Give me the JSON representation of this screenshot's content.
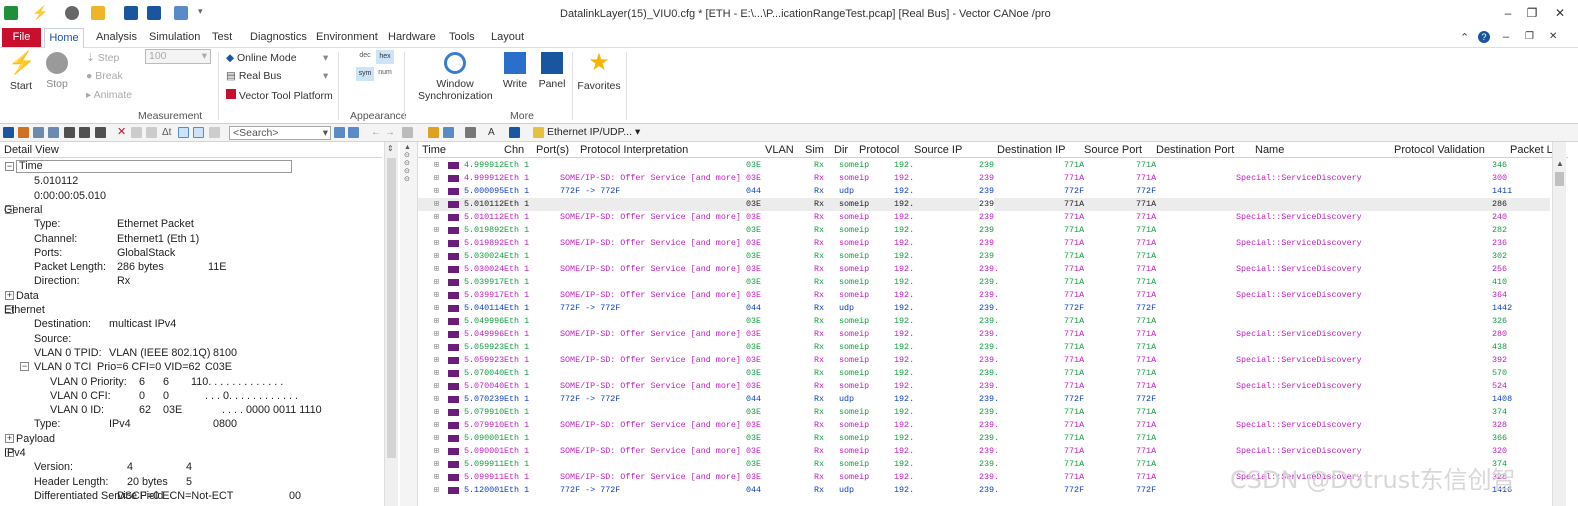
{
  "window": {
    "title": "DatalinkLayer(15)_VIU0.cfg * [ETH - E:\\...\\P...icationRangeTest.pcap] [Real Bus] - Vector CANoe /pro",
    "minimize": "–",
    "restore": "❐",
    "close": "✕",
    "ribbon_minimize": "–",
    "ribbon_restore": "❐",
    "ribbon_close": "✕"
  },
  "menu": {
    "file": "File",
    "tabs": [
      "Home",
      "Analysis",
      "Simulation",
      "Test",
      "Diagnostics",
      "Environment",
      "Hardware",
      "Tools",
      "Layout"
    ]
  },
  "ribbon": {
    "start": "Start",
    "stop": "Stop",
    "step": "Step",
    "break": "Break",
    "animate": "Animate",
    "step_value": "100",
    "online_mode": "Online Mode",
    "real_bus": "Real Bus",
    "vector_tool_platform": "Vector Tool Platform",
    "appearance_buttons": [
      "dec",
      "hex",
      "sym",
      "num"
    ],
    "window_sync": "Window Synchronization",
    "write": "Write",
    "panel": "Panel",
    "favorites": "Favorites",
    "groups": {
      "measurement": "Measurement",
      "appearance": "Appearance",
      "more": "More"
    }
  },
  "toolbar": {
    "search_placeholder": "<Search>",
    "filter_label": "Ethernet IP/UDP..."
  },
  "detail": {
    "header": "Detail View",
    "rows": [
      {
        "label": "Time",
        "col2": "",
        "col3": "",
        "col4": ""
      },
      {
        "label": "5.010112",
        "col2": "",
        "col3": "",
        "col4": ""
      },
      {
        "label": "0:00:00:05.010",
        "col2": "",
        "col3": "",
        "col4": ""
      },
      {
        "label": "General",
        "col2": "",
        "col3": "",
        "col4": ""
      },
      {
        "label": "Type:",
        "col2": "Ethernet Packet",
        "col3": "",
        "col4": ""
      },
      {
        "label": "Channel:",
        "col2": "Ethernet1 (Eth 1)",
        "col3": "",
        "col4": ""
      },
      {
        "label": "Ports:",
        "col2": "GlobalStack",
        "col3": "",
        "col4": ""
      },
      {
        "label": "Packet Length:",
        "col2": "286 bytes",
        "col3": "11E",
        "col4": ""
      },
      {
        "label": "Direction:",
        "col2": "Rx",
        "col3": "",
        "col4": ""
      },
      {
        "label": "Data",
        "col2": "",
        "col3": "",
        "col4": ""
      },
      {
        "label": "Ethernet",
        "col2": "",
        "col3": "",
        "col4": ""
      },
      {
        "label": "Destination:",
        "col2": "multicast IPv4",
        "col3": "",
        "col4": ""
      },
      {
        "label": "Source:",
        "col2": "",
        "col3": "",
        "col4": ""
      },
      {
        "label": "VLAN 0 TPID:",
        "col2": "VLAN (IEEE 802.1Q)",
        "col3": "8100",
        "col4": ""
      },
      {
        "label": "VLAN 0 TCI",
        "col2": "Prio=6 CFI=0 VID=62",
        "col3": "C03E",
        "col4": ""
      },
      {
        "label": "VLAN 0 Priority:",
        "col2": "6",
        "col3": "6",
        "col4": "110. . . . . . . . . . . . ."
      },
      {
        "label": "VLAN 0 CFI:",
        "col2": "0",
        "col3": "0",
        "col4": ". . . 0. . . . . . . . . . . ."
      },
      {
        "label": "VLAN 0 ID:",
        "col2": "62",
        "col3": "03E",
        "col4": ". . . . 0000 0011 1110"
      },
      {
        "label": "Type:",
        "col2": "IPv4",
        "col3": "0800",
        "col4": ""
      },
      {
        "label": "Payload",
        "col2": "",
        "col3": "",
        "col4": ""
      },
      {
        "label": "IPv4",
        "col2": "",
        "col3": "",
        "col4": ""
      },
      {
        "label": "Version:",
        "col2": "4",
        "col3": "4",
        "col4": ""
      },
      {
        "label": "Header Length:",
        "col2": "20 bytes",
        "col3": "5",
        "col4": ""
      },
      {
        "label": "Differentiated Service Field",
        "col2": "DSCP=0 ECN=Not-ECT",
        "col3": "00",
        "col4": ""
      }
    ]
  },
  "trace": {
    "columns": [
      "Time",
      "Chn",
      "Port(s)",
      "Protocol Interpretation",
      "VLAN",
      "Sim",
      "Dir",
      "Protocol",
      "Source IP",
      "Destination IP",
      "Source Port",
      "Destination Port",
      "Name",
      "Protocol Validation",
      "Packet Le"
    ],
    "rows": [
      {
        "time": "4.999912",
        "chn": "Eth 1",
        "interp": "",
        "vlan": "03E",
        "dir": "Rx",
        "proto": "someip",
        "src": "192.",
        "dst": "239",
        "sport": "771A",
        "dport": "771A",
        "name": "",
        "len": "346"
      },
      {
        "time": "4.999912",
        "chn": "Eth 1",
        "interp": "SOME/IP-SD: Offer Service [and more]",
        "vlan": "03E",
        "dir": "Rx",
        "proto": "someip",
        "src": "192.",
        "dst": "239",
        "sport": "771A",
        "dport": "771A",
        "name": "Special::ServiceDiscovery",
        "len": "300"
      },
      {
        "time": "5.000095",
        "chn": "Eth 1",
        "interp": "772F -> 772F",
        "vlan": "044",
        "dir": "Rx",
        "proto": "udp",
        "src": "192.",
        "dst": "239",
        "sport": "772F",
        "dport": "772F",
        "name": "",
        "len": "1411"
      },
      {
        "time": "5.010112",
        "chn": "Eth 1",
        "interp": "",
        "vlan": "03E",
        "dir": "Rx",
        "proto": "someip",
        "src": "192.",
        "dst": "239",
        "sport": "771A",
        "dport": "771A",
        "name": "",
        "len": "286"
      },
      {
        "time": "5.010112",
        "chn": "Eth 1",
        "interp": "SOME/IP-SD: Offer Service [and more]",
        "vlan": "03E",
        "dir": "Rx",
        "proto": "someip",
        "src": "192.",
        "dst": "239",
        "sport": "771A",
        "dport": "771A",
        "name": "Special::ServiceDiscovery",
        "len": "240"
      },
      {
        "time": "5.019892",
        "chn": "Eth 1",
        "interp": "",
        "vlan": "03E",
        "dir": "Rx",
        "proto": "someip",
        "src": "192.",
        "dst": "239",
        "sport": "771A",
        "dport": "771A",
        "name": "",
        "len": "282"
      },
      {
        "time": "5.019892",
        "chn": "Eth 1",
        "interp": "SOME/IP-SD: Offer Service [and more]",
        "vlan": "03E",
        "dir": "Rx",
        "proto": "someip",
        "src": "192.",
        "dst": "239",
        "sport": "771A",
        "dport": "771A",
        "name": "Special::ServiceDiscovery",
        "len": "236"
      },
      {
        "time": "5.030024",
        "chn": "Eth 1",
        "interp": "",
        "vlan": "03E",
        "dir": "Rx",
        "proto": "someip",
        "src": "192.",
        "dst": "239",
        "sport": "771A",
        "dport": "771A",
        "name": "",
        "len": "302"
      },
      {
        "time": "5.030024",
        "chn": "Eth 1",
        "interp": "SOME/IP-SD: Offer Service [and more]",
        "vlan": "03E",
        "dir": "Rx",
        "proto": "someip",
        "src": "192.",
        "dst": "239.",
        "sport": "771A",
        "dport": "771A",
        "name": "Special::ServiceDiscovery",
        "len": "256"
      },
      {
        "time": "5.039917",
        "chn": "Eth 1",
        "interp": "",
        "vlan": "03E",
        "dir": "Rx",
        "proto": "someip",
        "src": "192.",
        "dst": "239.",
        "sport": "771A",
        "dport": "771A",
        "name": "",
        "len": "410"
      },
      {
        "time": "5.039917",
        "chn": "Eth 1",
        "interp": "SOME/IP-SD: Offer Service [and more]",
        "vlan": "03E",
        "dir": "Rx",
        "proto": "someip",
        "src": "192.",
        "dst": "239.",
        "sport": "771A",
        "dport": "771A",
        "name": "Special::ServiceDiscovery",
        "len": "364"
      },
      {
        "time": "5.040114",
        "chn": "Eth 1",
        "interp": "772F -> 772F",
        "vlan": "044",
        "dir": "Rx",
        "proto": "udp",
        "src": "192.",
        "dst": "239.",
        "sport": "772F",
        "dport": "772F",
        "name": "",
        "len": "1442"
      },
      {
        "time": "5.049996",
        "chn": "Eth 1",
        "interp": "",
        "vlan": "03E",
        "dir": "Rx",
        "proto": "someip",
        "src": "192.",
        "dst": "239.",
        "sport": "771A",
        "dport": "771A",
        "name": "",
        "len": "326"
      },
      {
        "time": "5.049996",
        "chn": "Eth 1",
        "interp": "SOME/IP-SD: Offer Service [and more]",
        "vlan": "03E",
        "dir": "Rx",
        "proto": "someip",
        "src": "192.",
        "dst": "239.",
        "sport": "771A",
        "dport": "771A",
        "name": "Special::ServiceDiscovery",
        "len": "280"
      },
      {
        "time": "5.059923",
        "chn": "Eth 1",
        "interp": "",
        "vlan": "03E",
        "dir": "Rx",
        "proto": "someip",
        "src": "192.",
        "dst": "239.",
        "sport": "771A",
        "dport": "771A",
        "name": "",
        "len": "438"
      },
      {
        "time": "5.059923",
        "chn": "Eth 1",
        "interp": "SOME/IP-SD: Offer Service [and more]",
        "vlan": "03E",
        "dir": "Rx",
        "proto": "someip",
        "src": "192.",
        "dst": "239.",
        "sport": "771A",
        "dport": "771A",
        "name": "Special::ServiceDiscovery",
        "len": "392"
      },
      {
        "time": "5.070040",
        "chn": "Eth 1",
        "interp": "",
        "vlan": "03E",
        "dir": "Rx",
        "proto": "someip",
        "src": "192.",
        "dst": "239.",
        "sport": "771A",
        "dport": "771A",
        "name": "",
        "len": "570"
      },
      {
        "time": "5.070040",
        "chn": "Eth 1",
        "interp": "SOME/IP-SD: Offer Service [and more]",
        "vlan": "03E",
        "dir": "Rx",
        "proto": "someip",
        "src": "192.",
        "dst": "239.",
        "sport": "771A",
        "dport": "771A",
        "name": "Special::ServiceDiscovery",
        "len": "524"
      },
      {
        "time": "5.070239",
        "chn": "Eth 1",
        "interp": "772F -> 772F",
        "vlan": "044",
        "dir": "Rx",
        "proto": "udp",
        "src": "192.",
        "dst": "239.",
        "sport": "772F",
        "dport": "772F",
        "name": "",
        "len": "1408"
      },
      {
        "time": "5.079910",
        "chn": "Eth 1",
        "interp": "",
        "vlan": "03E",
        "dir": "Rx",
        "proto": "someip",
        "src": "192.",
        "dst": "239.",
        "sport": "771A",
        "dport": "771A",
        "name": "",
        "len": "374"
      },
      {
        "time": "5.079910",
        "chn": "Eth 1",
        "interp": "SOME/IP-SD: Offer Service [and more]",
        "vlan": "03E",
        "dir": "Rx",
        "proto": "someip",
        "src": "192.",
        "dst": "239.",
        "sport": "771A",
        "dport": "771A",
        "name": "Special::ServiceDiscovery",
        "len": "328"
      },
      {
        "time": "5.090001",
        "chn": "Eth 1",
        "interp": "",
        "vlan": "03E",
        "dir": "Rx",
        "proto": "someip",
        "src": "192.",
        "dst": "239.",
        "sport": "771A",
        "dport": "771A",
        "name": "",
        "len": "366"
      },
      {
        "time": "5.090001",
        "chn": "Eth 1",
        "interp": "SOME/IP-SD: Offer Service [and more]",
        "vlan": "03E",
        "dir": "Rx",
        "proto": "someip",
        "src": "192.",
        "dst": "239.",
        "sport": "771A",
        "dport": "771A",
        "name": "Special::ServiceDiscovery",
        "len": "320"
      },
      {
        "time": "5.099911",
        "chn": "Eth 1",
        "interp": "",
        "vlan": "03E",
        "dir": "Rx",
        "proto": "someip",
        "src": "192.",
        "dst": "239.",
        "sport": "771A",
        "dport": "771A",
        "name": "",
        "len": "374"
      },
      {
        "time": "5.099911",
        "chn": "Eth 1",
        "interp": "SOME/IP-SD: Offer Service [and more]",
        "vlan": "03E",
        "dir": "Rx",
        "proto": "someip",
        "src": "192.",
        "dst": "239.",
        "sport": "771A",
        "dport": "771A",
        "name": "Special::ServiceDiscovery",
        "len": "328"
      },
      {
        "time": "5.120001",
        "chn": "Eth 1",
        "interp": "772F -> 772F",
        "vlan": "044",
        "dir": "Rx",
        "proto": "udp",
        "src": "192.",
        "dst": "239.",
        "sport": "772F",
        "dport": "772F",
        "name": "",
        "len": "1416"
      }
    ]
  },
  "watermark": "CSDN @Dotrust东信创智",
  "colors": {
    "file_tab": "#c8102e",
    "sd_text": "#c020c0",
    "udp_text": "#1040c0",
    "someip_text": "#10a040",
    "selected_row": "#ececec"
  }
}
